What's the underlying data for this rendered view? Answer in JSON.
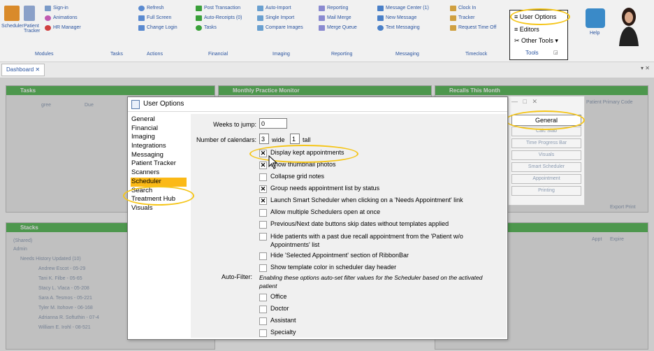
{
  "ribbon": {
    "modules_group": {
      "scheduler": "Scheduler",
      "patient_tracker": "Patient Tracker",
      "sign_in": "Sign-in",
      "animations": "Animations",
      "hr_manager": "HR Manager",
      "label": "Modules"
    },
    "tasks_label": "Tasks",
    "actions_group": {
      "refresh": "Refresh",
      "full_screen": "Full Screen",
      "change_login": "Change Login",
      "label": "Actions"
    },
    "financial_group": {
      "post_transaction": "Post Transaction",
      "auto_receipts": "Auto-Receipts (0)",
      "tasks": "Tasks",
      "label": "Financial"
    },
    "imaging_group": {
      "auto_import": "Auto-Import",
      "single_import": "Single Import",
      "compare_images": "Compare Images",
      "label": "Imaging"
    },
    "reporting_group": {
      "reporting": "Reporting",
      "mail_merge": "Mail Merge",
      "merge_queue": "Merge Queue",
      "label": "Reporting"
    },
    "messaging_group": {
      "message_center": "Message Center (1)",
      "new_message": "New Message",
      "text_messaging": "Text Messaging",
      "label": "Messaging"
    },
    "timeclock_group": {
      "clock_in": "Clock In",
      "tracker": "Tracker",
      "request_time_off": "Request Time Off",
      "label": "Timeclock"
    },
    "tools_group": {
      "user_options": "User Options",
      "editors": "Editors",
      "other_tools": "Other Tools",
      "label": "Tools"
    },
    "help_label": "Help"
  },
  "tabs": {
    "dashboard": "Dashboard"
  },
  "background": {
    "tasks_title": "Tasks",
    "tasks_cols": [
      "gree",
      "Due"
    ],
    "monthly_title": "Monthly Practice Monitor",
    "recalls_title": "Recalls This Month",
    "patient_primary_code": "Patient Primary Code",
    "export_print": "Export Print",
    "stacks_title": "Stacks",
    "tree": [
      "(Shared)",
      "Admin",
      "Needs History Updated (10)",
      "Andrew Escot - 05-29",
      "Tani K. Filbe - 05-65",
      "Stacy L. Vlaca - 05-208",
      "Sara A. Tesmos - 05-221",
      "Tyler M. Itohove - 06-168",
      "Adrianna R. Softuthin - 07-4",
      "William E. Irohl - 08-521"
    ],
    "cols_right": [
      "Appt",
      "Expire"
    ]
  },
  "dialog": {
    "title": "User Options",
    "nav": [
      "General",
      "Financial",
      "Imaging",
      "Integrations",
      "Messaging",
      "Patient Tracker",
      "Scanners",
      "Scheduler",
      "Search",
      "Treatment Hub",
      "Visuals"
    ],
    "selected_nav": "Scheduler",
    "weeks_to_jump_label": "Weeks to jump:",
    "weeks_to_jump_value": "0",
    "num_calendars_label": "Number of calendars:",
    "wide_value": "3",
    "wide_label": "wide",
    "tall_value": "1",
    "tall_label": "tall",
    "options": [
      {
        "label": "Display kept appointments",
        "checked": true
      },
      {
        "label": "Show thumbnail photos",
        "checked": true
      },
      {
        "label": "Collapse grid notes",
        "checked": false
      },
      {
        "label": "Group needs appointment list by status",
        "checked": true
      },
      {
        "label": "Launch Smart Scheduler when clicking on a 'Needs Appointment' link",
        "checked": true
      },
      {
        "label": "Allow multiple Schedulers open at once",
        "checked": false
      },
      {
        "label": "Previous/Next date buttons skip dates without templates applied",
        "checked": false
      },
      {
        "label": "Hide patients with a past due recall appointment from the 'Patient w/o Appointments' list",
        "checked": false
      },
      {
        "label": "Hide 'Selected Appointment' section of RibbonBar",
        "checked": false
      },
      {
        "label": "Show template color in scheduler day header",
        "checked": false
      }
    ],
    "auto_filter_label": "Auto-Filter:",
    "auto_filter_note": "Enabling these options auto-set filter values for the Scheduler based on the activated patient",
    "filters": [
      {
        "label": "Office",
        "checked": false
      },
      {
        "label": "Doctor",
        "checked": false
      },
      {
        "label": "Assistant",
        "checked": false
      },
      {
        "label": "Specialty",
        "checked": false
      }
    ]
  },
  "side_panel": {
    "buttons": [
      "General",
      "Calc Slab",
      "Time Progress Bar",
      "Visuals",
      "Smart Scheduler",
      "Appointment",
      "Printing"
    ],
    "active": "General"
  },
  "colors": {
    "highlight": "#f5c518",
    "selection": "#fbb917",
    "panel_header": "#3cae3c"
  }
}
